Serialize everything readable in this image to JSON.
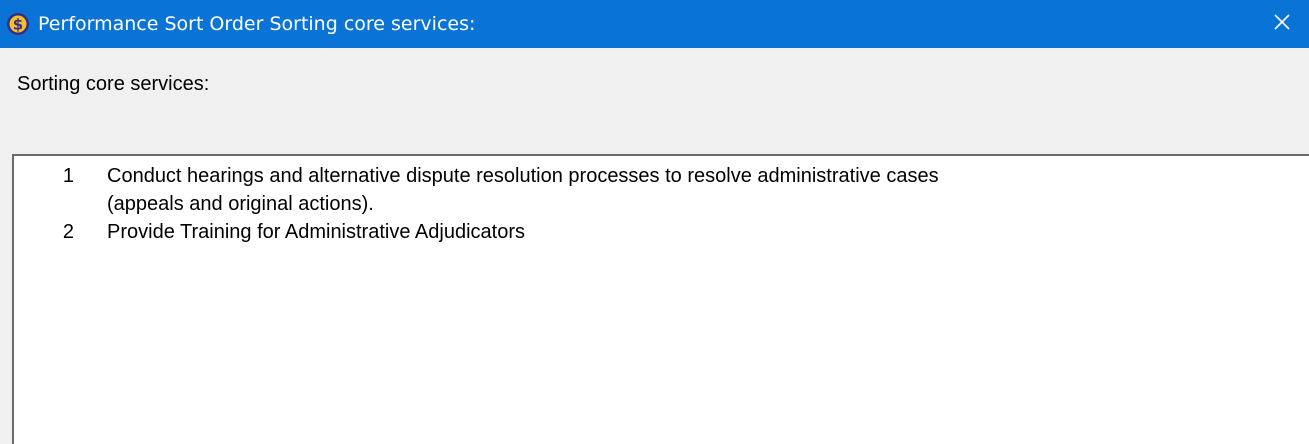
{
  "window": {
    "title": "Performance Sort Order Sorting core services:",
    "app_icon": "dollar-coin-icon",
    "close_icon": "close-icon",
    "titlebar_color": "#0a74d6"
  },
  "prompt": {
    "label": "Sorting core services:"
  },
  "list": {
    "items": [
      {
        "number": "1",
        "text_line1": "Conduct hearings and alternative dispute resolution processes to resolve administrative cases",
        "text_line2": "(appeals and original actions)."
      },
      {
        "number": "2",
        "text_line1": "Provide Training for Administrative Adjudicators",
        "text_line2": ""
      }
    ]
  }
}
